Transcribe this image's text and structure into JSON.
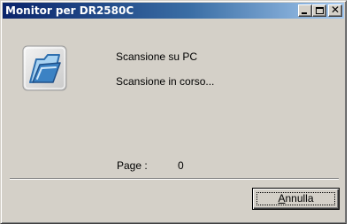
{
  "window": {
    "title": "Monitor per DR2580C",
    "controls": {
      "minimize_icon": "minimize-icon",
      "maximize_icon": "maximize-icon",
      "close_icon": "close-icon",
      "close_glyph": "✕"
    },
    "titlebar_colors": [
      "#0a246a",
      "#a6caf0"
    ],
    "face_color": "#d4d0c8"
  },
  "icon": {
    "name": "scanner-document-icon",
    "colors": {
      "frame": "#d9d9d9",
      "blue": "#3b82c4",
      "light_blue": "#a9d3f2"
    }
  },
  "status": {
    "line1": "Scansione su PC",
    "line2": "Scansione in corso..."
  },
  "page": {
    "label": "Page :",
    "value": "0"
  },
  "buttons": {
    "cancel": {
      "mnemonic": "A",
      "rest": "nnulla"
    }
  }
}
